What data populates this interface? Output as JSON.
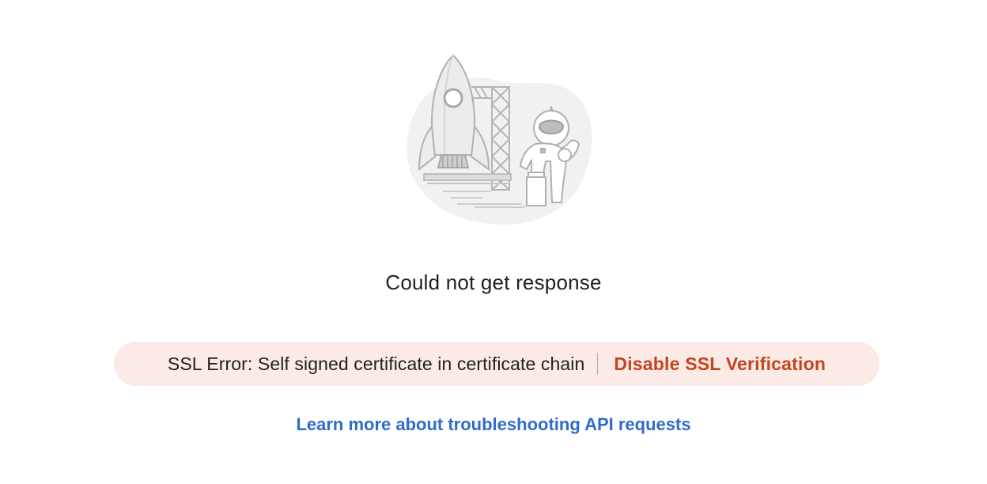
{
  "response": {
    "title": "Could not get response",
    "illustration_icon": "rocket-astronaut-illustration",
    "error": {
      "message": "SSL Error: Self signed certificate in certificate chain",
      "action_label": "Disable SSL Verification",
      "banner_color": "#fbeae5",
      "action_color": "#c4441d"
    },
    "help_link": {
      "label": "Learn more about troubleshooting API requests",
      "color": "#2f6bc9"
    }
  }
}
